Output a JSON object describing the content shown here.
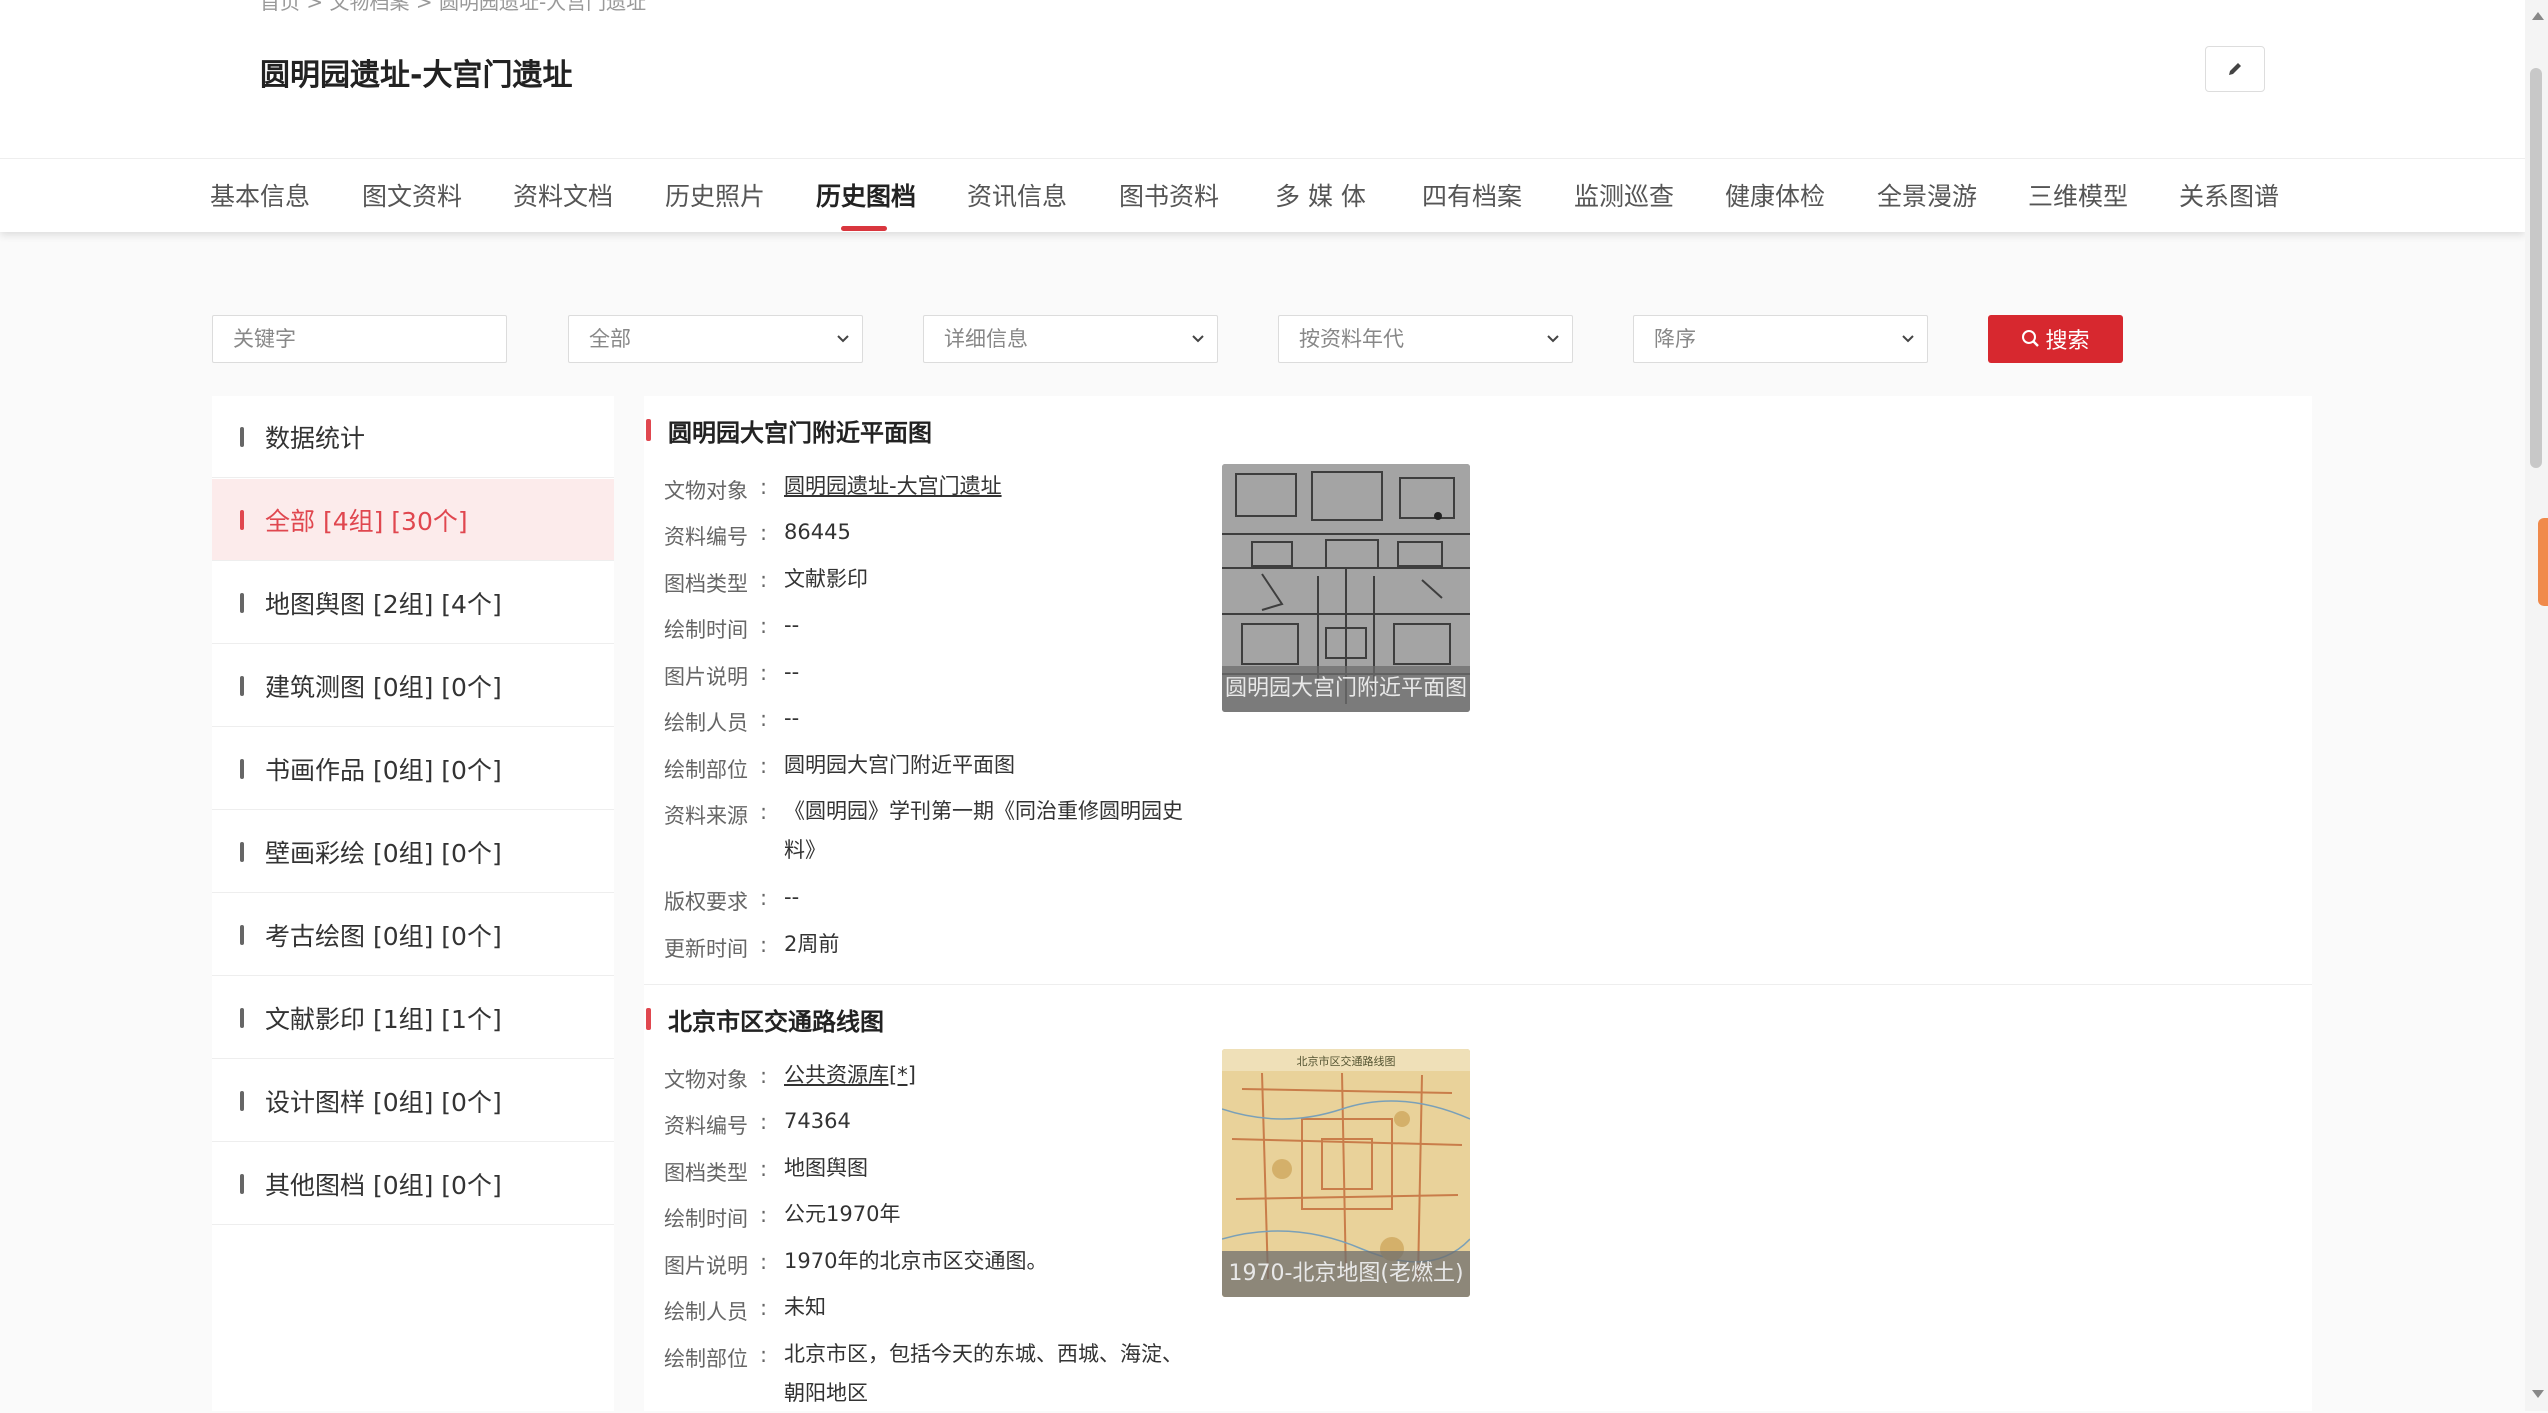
{
  "header": {
    "breadcrumb": "首页 > 文物档案 > 圆明园遗址-大宫门遗址",
    "title": "圆明园遗址-大宫门遗址"
  },
  "tabs": [
    {
      "label": "基本信息"
    },
    {
      "label": "图文资料"
    },
    {
      "label": "资料文档"
    },
    {
      "label": "历史照片"
    },
    {
      "label": "历史图档",
      "active": true
    },
    {
      "label": "资讯信息"
    },
    {
      "label": "图书资料"
    },
    {
      "label": "多 媒 体"
    },
    {
      "label": "四有档案"
    },
    {
      "label": "监测巡查"
    },
    {
      "label": "健康体检"
    },
    {
      "label": "全景漫游"
    },
    {
      "label": "三维模型"
    },
    {
      "label": "关系图谱"
    }
  ],
  "filters": {
    "keyword_placeholder": "关键字",
    "category": "全部",
    "detail": "详细信息",
    "sort_by": "按资料年代",
    "order": "降序",
    "search_label": "搜索"
  },
  "sidebar": {
    "items": [
      {
        "label": "数据统计"
      },
      {
        "label": "全部 [4组] [30个]",
        "active": true
      },
      {
        "label": "地图舆图 [2组] [4个]"
      },
      {
        "label": "建筑测图 [0组] [0个]"
      },
      {
        "label": "书画作品 [0组] [0个]"
      },
      {
        "label": "壁画彩绘 [0组] [0个]"
      },
      {
        "label": "考古绘图 [0组] [0个]"
      },
      {
        "label": "文献影印 [1组] [1个]"
      },
      {
        "label": "设计图样 [0组] [0个]"
      },
      {
        "label": "其他图档 [0组] [0个]"
      }
    ]
  },
  "records": [
    {
      "title": "圆明园大宫门附近平面图",
      "thumb_caption": "圆明园大宫门附近平面图",
      "fields": [
        {
          "label": "文物对象",
          "value": "圆明园遗址-大宫门遗址"
        },
        {
          "label": "资料编号",
          "value": "86445"
        },
        {
          "label": "图档类型",
          "value": "文献影印"
        },
        {
          "label": "绘制时间",
          "value": "--"
        },
        {
          "label": "图片说明",
          "value": "--"
        },
        {
          "label": "绘制人员",
          "value": "--"
        },
        {
          "label": "绘制部位",
          "value": "圆明园大宫门附近平面图"
        },
        {
          "label": "资料来源",
          "value": "《圆明园》学刊第一期《同治重修圆明园史料》"
        },
        {
          "label": "版权要求",
          "value": "--"
        },
        {
          "label": "更新时间",
          "value": "2周前"
        }
      ]
    },
    {
      "title": "北京市区交通路线图",
      "thumb_caption": "1970-北京地图(老燃土)",
      "map_title": "北京市区交通路线图",
      "fields": [
        {
          "label": "文物对象",
          "value": "公共资源库[*]"
        },
        {
          "label": "资料编号",
          "value": "74364"
        },
        {
          "label": "图档类型",
          "value": "地图舆图"
        },
        {
          "label": "绘制时间",
          "value": "公元1970年"
        },
        {
          "label": "图片说明",
          "value": "1970年的北京市区交通图。"
        },
        {
          "label": "绘制人员",
          "value": "未知"
        },
        {
          "label": "绘制部位",
          "value": "北京市区，包括今天的东城、西城、海淀、朝阳地区"
        }
      ]
    }
  ]
}
